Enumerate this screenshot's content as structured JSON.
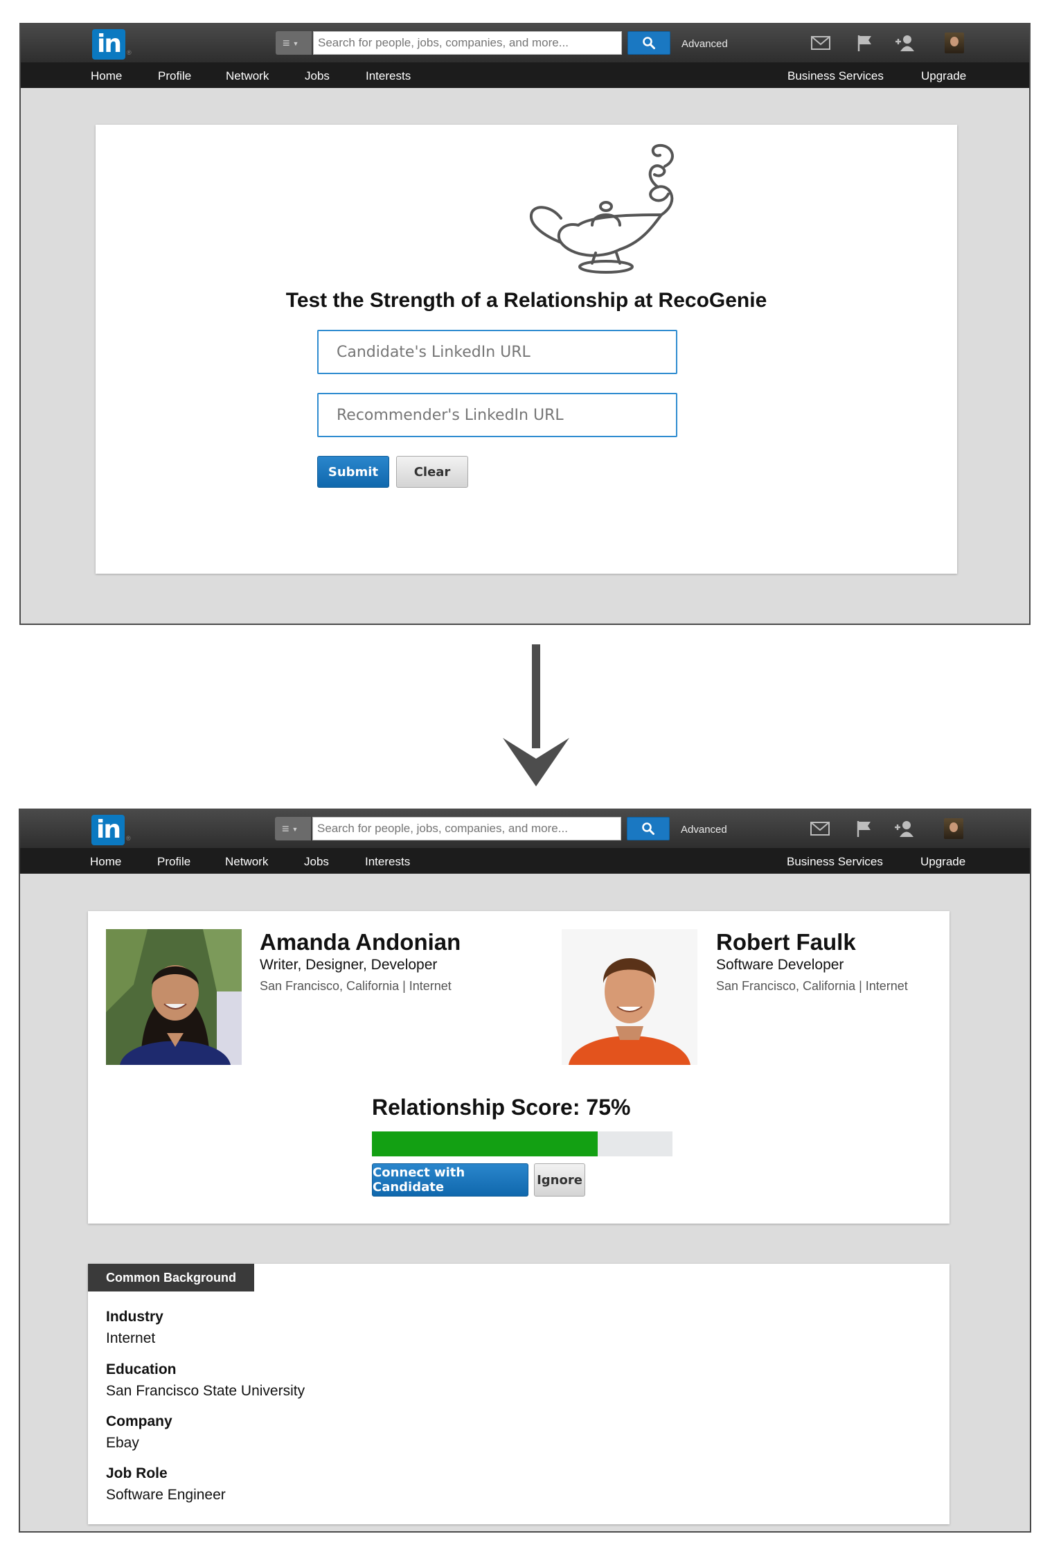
{
  "header": {
    "logo_text": "in",
    "logo_mark": "®",
    "search_placeholder": "Search for people, jobs, companies, and more...",
    "advanced_label": "Advanced",
    "icons": [
      "messages-icon",
      "flag-icon",
      "add-connection-icon",
      "profile-avatar"
    ]
  },
  "nav": {
    "home": "Home",
    "profile": "Profile",
    "network": "Network",
    "jobs": "Jobs",
    "interests": "Interests",
    "business_services": "Business Services",
    "upgrade": "Upgrade"
  },
  "form": {
    "headline": "Test the Strength of a Relationship at RecoGenie",
    "candidate_placeholder": "Candidate's LinkedIn URL",
    "recommender_placeholder": "Recommender's LinkedIn URL",
    "submit_label": "Submit",
    "clear_label": "Clear"
  },
  "result": {
    "candidate": {
      "name": "Amanda Andonian",
      "title": "Writer, Designer, Developer",
      "location": "San Francisco, California | Internet"
    },
    "recommender": {
      "name": "Robert Faulk",
      "title": "Software Developer",
      "location": "San Francisco, California | Internet"
    },
    "score_label": "Relationship Score: 75%",
    "score_fraction": 0.75,
    "connect_label": "Connect with Candidate",
    "ignore_label": "Ignore"
  },
  "common_background": {
    "tab_label": "Common Background",
    "items": [
      {
        "label": "Industry",
        "value": "Internet"
      },
      {
        "label": "Education",
        "value": "San Francisco State University"
      },
      {
        "label": "Company",
        "value": "Ebay"
      },
      {
        "label": "Job Role",
        "value": "Software Engineer"
      }
    ]
  },
  "colors": {
    "brand_blue": "#0b79c1",
    "progress_green": "#13a013",
    "nav_dark": "#1c1c1c"
  }
}
